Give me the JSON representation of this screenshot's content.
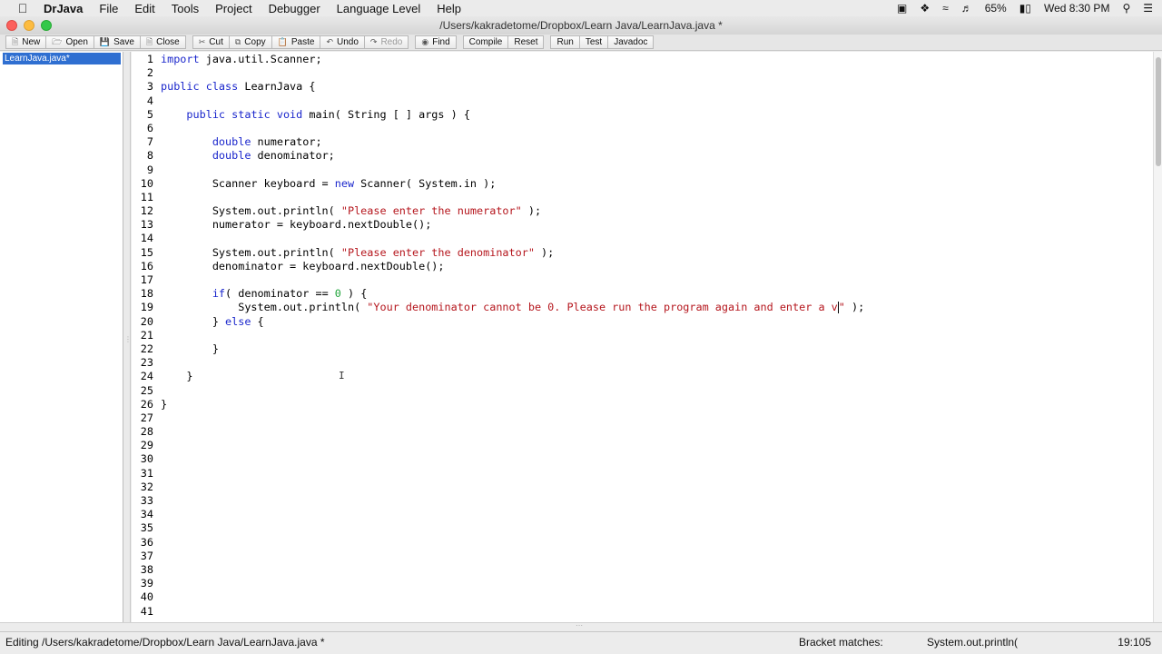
{
  "menubar": {
    "app_name": "DrJava",
    "menus": [
      "File",
      "Edit",
      "Tools",
      "Project",
      "Debugger",
      "Language Level",
      "Help"
    ],
    "battery": "65%",
    "clock": "Wed 8:30 PM"
  },
  "window": {
    "title": "/Users/kakradetome/Dropbox/Learn Java/LearnJava.java *"
  },
  "toolbar": {
    "new": "New",
    "open": "Open",
    "save": "Save",
    "close": "Close",
    "cut": "Cut",
    "copy": "Copy",
    "paste": "Paste",
    "undo": "Undo",
    "redo": "Redo",
    "find": "Find",
    "compile": "Compile",
    "reset": "Reset",
    "run": "Run",
    "test": "Test",
    "javadoc": "Javadoc"
  },
  "files": {
    "open_file": "LearnJava.java*"
  },
  "editor": {
    "line_count": 41,
    "lines": [
      [
        {
          "t": "import",
          "c": "kw"
        },
        {
          "t": " java.util.Scanner;",
          "c": "txt"
        }
      ],
      [],
      [
        {
          "t": "public class",
          "c": "kw"
        },
        {
          "t": " LearnJava {",
          "c": "txt"
        }
      ],
      [],
      [
        {
          "t": "    ",
          "c": "txt"
        },
        {
          "t": "public static void",
          "c": "kw"
        },
        {
          "t": " main( String [ ] args ) {",
          "c": "txt"
        }
      ],
      [],
      [
        {
          "t": "        ",
          "c": "txt"
        },
        {
          "t": "double",
          "c": "kw"
        },
        {
          "t": " numerator;",
          "c": "txt"
        }
      ],
      [
        {
          "t": "        ",
          "c": "txt"
        },
        {
          "t": "double",
          "c": "kw"
        },
        {
          "t": " denominator;",
          "c": "txt"
        }
      ],
      [],
      [
        {
          "t": "        Scanner keyboard = ",
          "c": "txt"
        },
        {
          "t": "new",
          "c": "kw"
        },
        {
          "t": " Scanner( System.in );",
          "c": "txt"
        }
      ],
      [],
      [
        {
          "t": "        System.out.println( ",
          "c": "txt"
        },
        {
          "t": "\"Please enter the numerator\"",
          "c": "str"
        },
        {
          "t": " );",
          "c": "txt"
        }
      ],
      [
        {
          "t": "        numerator = keyboard.nextDouble();",
          "c": "txt"
        }
      ],
      [],
      [
        {
          "t": "        System.out.println( ",
          "c": "txt"
        },
        {
          "t": "\"Please enter the denominator\"",
          "c": "str"
        },
        {
          "t": " );",
          "c": "txt"
        }
      ],
      [
        {
          "t": "        denominator = keyboard.nextDouble();",
          "c": "txt"
        }
      ],
      [],
      [
        {
          "t": "        ",
          "c": "txt"
        },
        {
          "t": "if",
          "c": "kw"
        },
        {
          "t": "( denominator == ",
          "c": "txt"
        },
        {
          "t": "0",
          "c": "num"
        },
        {
          "t": " ) {",
          "c": "txt"
        }
      ],
      [
        {
          "t": "            System.out.println( ",
          "c": "txt"
        },
        {
          "t": "\"Your denominator cannot be 0. Please run the program again and enter a v",
          "c": "str"
        },
        {
          "t": "|caret|",
          "c": "caret"
        },
        {
          "t": "\"",
          "c": "str"
        },
        {
          "t": " );",
          "c": "txt"
        }
      ],
      [
        {
          "t": "        } ",
          "c": "txt"
        },
        {
          "t": "else",
          "c": "kw"
        },
        {
          "t": " {",
          "c": "txt"
        }
      ],
      [],
      [
        {
          "t": "        }",
          "c": "txt"
        }
      ],
      [],
      [
        {
          "t": "    }",
          "c": "txt"
        }
      ],
      [],
      [
        {
          "t": "}",
          "c": "txt"
        }
      ]
    ]
  },
  "status": {
    "editing": "Editing /Users/kakradetome/Dropbox/Learn Java/LearnJava.java *",
    "bracket_label": "Bracket matches:",
    "bracket_value": "System.out.println(",
    "position": "19:105"
  }
}
